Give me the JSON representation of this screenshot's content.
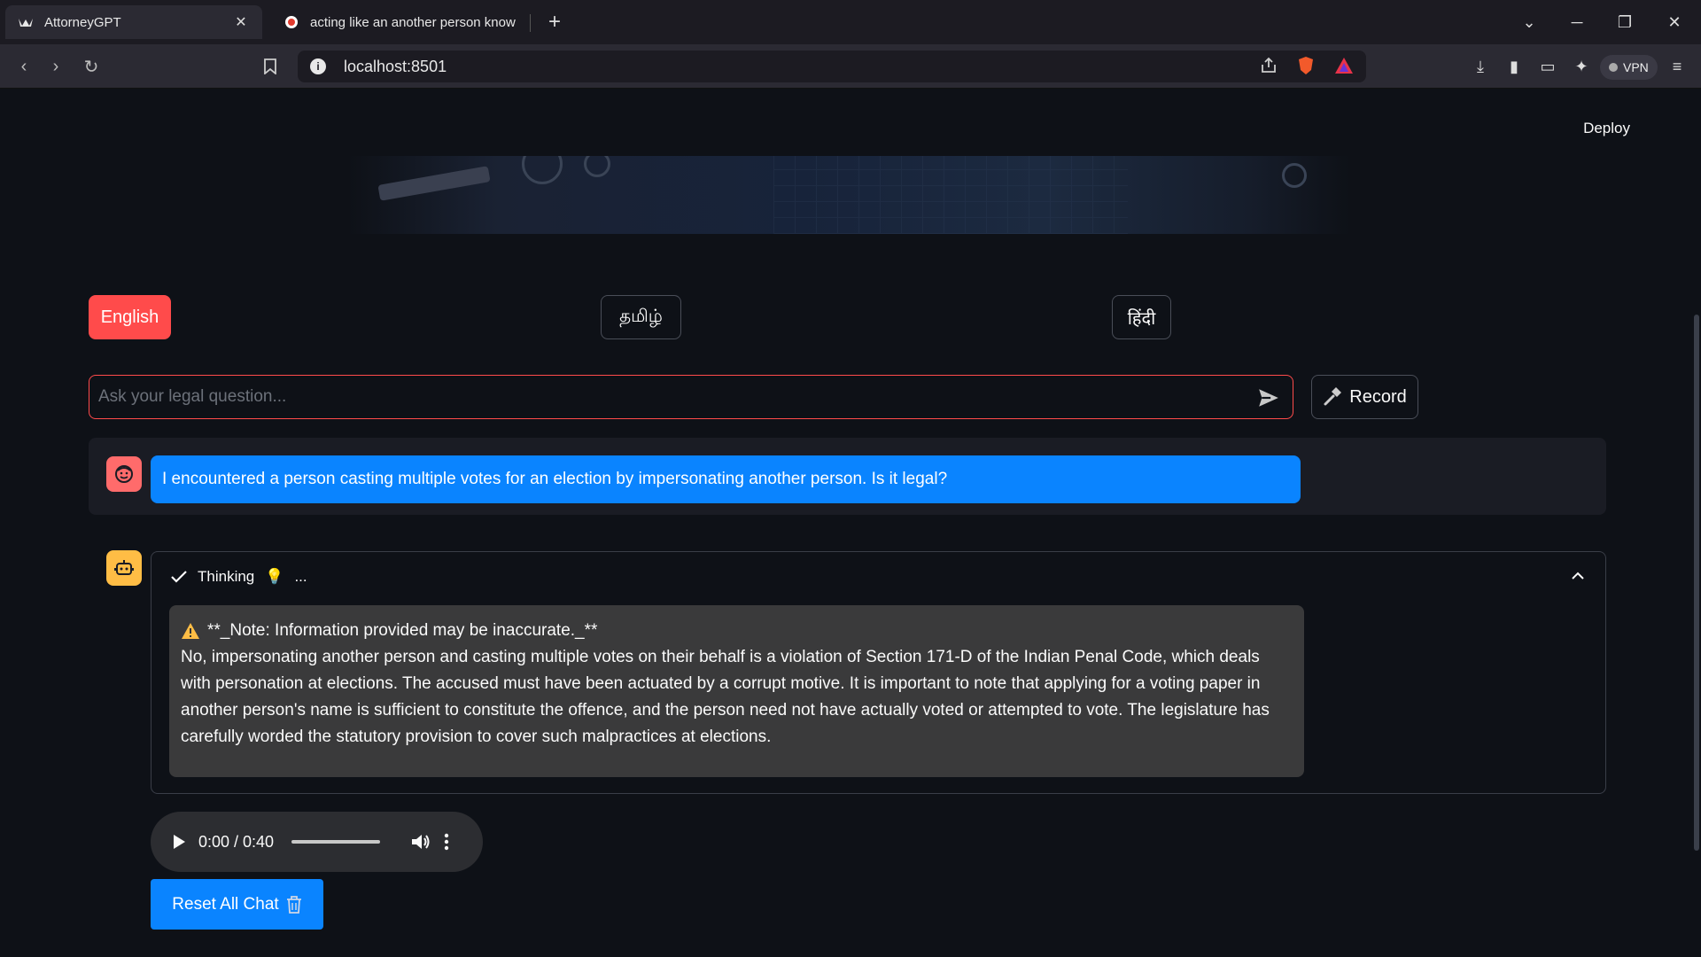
{
  "browser": {
    "tabs": [
      {
        "title": "AttorneyGPT",
        "active": true
      },
      {
        "title": "acting like an another person know",
        "active": false
      }
    ],
    "url": "localhost:8501",
    "vpn_label": "VPN"
  },
  "app": {
    "deploy_label": "Deploy",
    "languages": [
      {
        "label": "English",
        "selected": true
      },
      {
        "label": "தமிழ்",
        "selected": false
      },
      {
        "label": "हिंदी",
        "selected": false
      }
    ],
    "input": {
      "placeholder": "Ask your legal question..."
    },
    "record_label": "Record",
    "user_message": "I encountered a person casting multiple votes for an election by impersonating another person. Is it legal?",
    "thinking": {
      "label": "Thinking",
      "suffix": "...",
      "note": "**_Note: Information provided may be inaccurate._**",
      "answer": "No, impersonating another person and casting multiple votes on their behalf is a violation of Section 171-D of the Indian Penal Code, which deals with personation at elections. The accused must have been actuated by a corrupt motive. It is important to note that applying for a voting paper in another person's name is sufficient to constitute the offence, and the person need not have actually voted or attempted to vote. The legislature has carefully worded the statutory provision to cover such malpractices at elections."
    },
    "audio": {
      "time": "0:00 / 0:40",
      "progress": 0
    },
    "reset_label": "Reset All Chat",
    "colors": {
      "primary": "#ff4b4b",
      "accent": "#0a84ff",
      "background": "#0e1117"
    }
  }
}
